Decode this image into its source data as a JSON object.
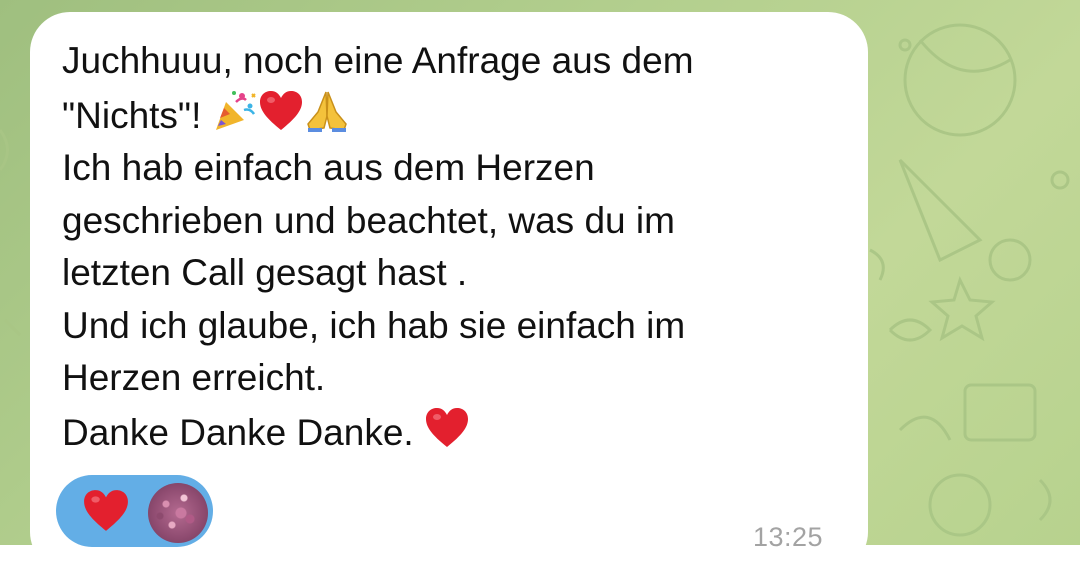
{
  "message": {
    "line1": "Juchhuuu, noch eine Anfrage aus dem",
    "line2_text": "\"Nichts\"!",
    "line2_emojis": [
      "party-popper-icon",
      "red-heart-icon",
      "folded-hands-icon"
    ],
    "line3": "Ich hab einfach aus dem Herzen",
    "line4": "geschrieben und beachtet, was du im",
    "line5": "letzten Call gesagt hast .",
    "line6": "Und ich glaube, ich hab sie einfach im",
    "line7": "Herzen erreicht.",
    "line8_text": "Danke Danke Danke.",
    "line8_emoji": "red-heart-icon",
    "timestamp": "13:25"
  },
  "reaction": {
    "emoji": "red-heart-icon",
    "reactor": "avatar"
  },
  "colors": {
    "background": "#b3cf8e",
    "bubble": "#ffffff",
    "text": "#111111",
    "reaction_pill": "#63aee6",
    "heart": "#e3202e",
    "timestamp": "#a3a3a3"
  }
}
